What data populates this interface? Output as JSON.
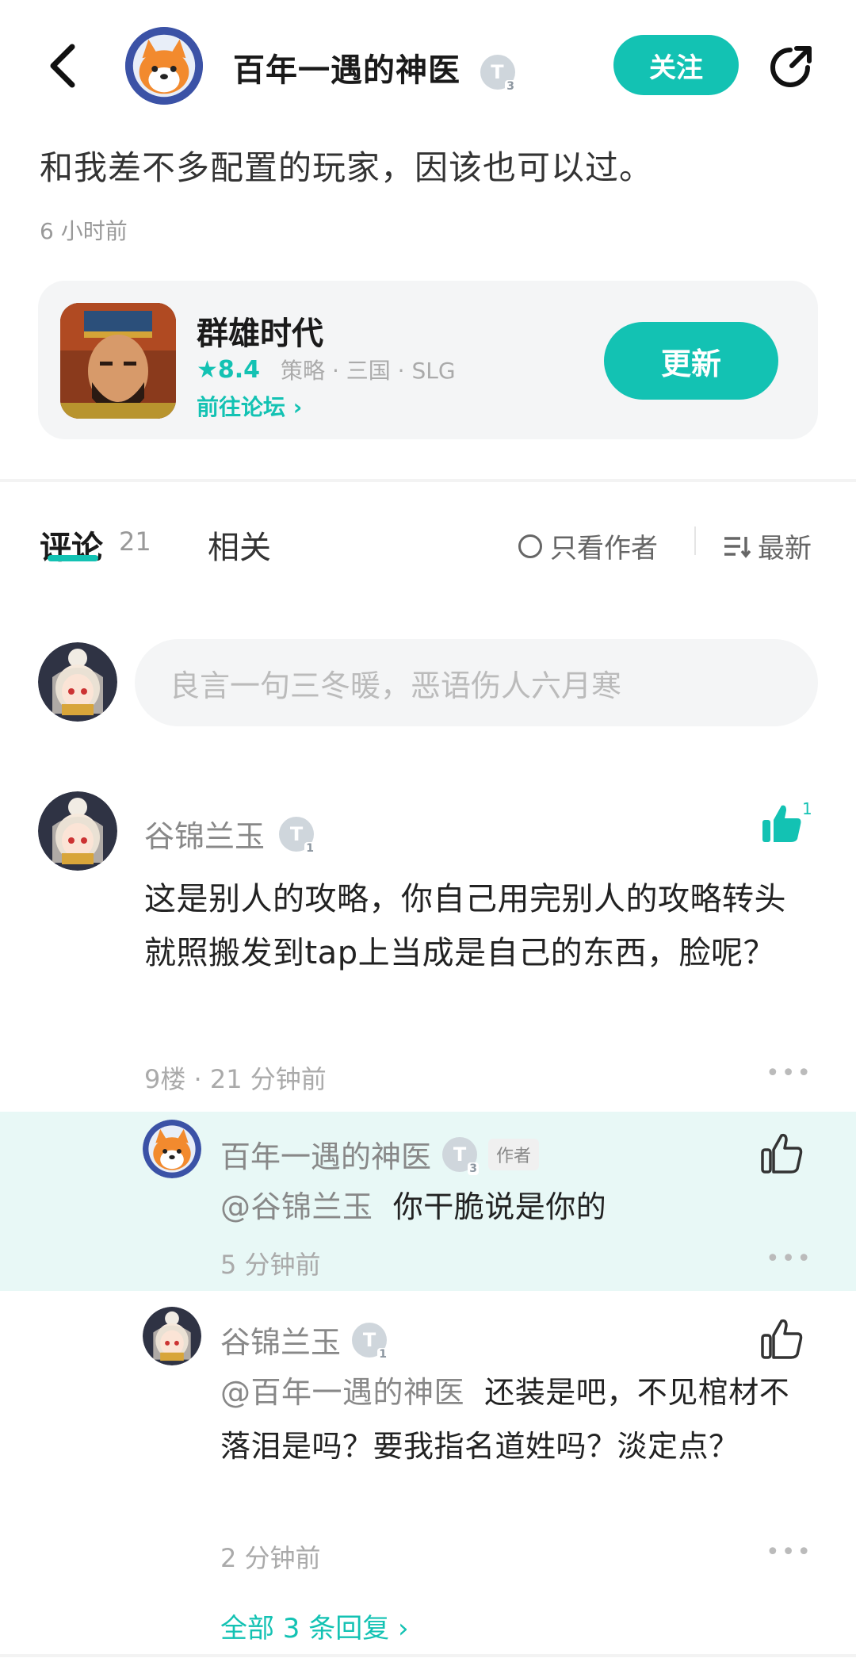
{
  "header": {
    "author_name": "百年一遇的神医",
    "author_badge": "T",
    "author_badge_level": "3",
    "follow_label": "关注"
  },
  "post": {
    "text": "和我差不多配置的玩家，因该也可以过。",
    "time": "6 小时前"
  },
  "game_card": {
    "title": "群雄时代",
    "rating": "★8.4",
    "tags": "策略 · 三国 · SLG",
    "forum_link": "前往论坛 ›",
    "update_label": "更新"
  },
  "tabs": {
    "comments_label": "评论",
    "comments_count": "21",
    "related_label": "相关",
    "only_author_label": "只看作者",
    "sort_label": "最新"
  },
  "comment_input": {
    "placeholder": "良言一句三冬暖，恶语伤人六月寒"
  },
  "comment": {
    "user": "谷锦兰玉",
    "badge": "T",
    "badge_level": "1",
    "likes": "1",
    "text": "这是别人的攻略，你自己用完别人的攻略转头就照搬发到tap上当成是自己的东西，脸呢？",
    "meta": "9楼 · 21 分钟前",
    "more": "•••"
  },
  "replies": [
    {
      "user": "百年一遇的神医",
      "badge": "T",
      "badge_level": "3",
      "author_tag": "作者",
      "mention": "@谷锦兰玉",
      "text": "你干脆说是你的",
      "time": "5 分钟前",
      "more": "•••"
    },
    {
      "user": "谷锦兰玉",
      "badge": "T",
      "badge_level": "1",
      "mention": "@百年一遇的神医",
      "text": "还装是吧，不见棺材不落泪是吗？要我指名道姓吗？淡定点？",
      "time": "2 分钟前",
      "more": "•••"
    }
  ],
  "all_replies_label": "全部 3 条回复 ›",
  "colors": {
    "accent": "#13c2b3",
    "reply_highlight": "#e8f8f6"
  }
}
